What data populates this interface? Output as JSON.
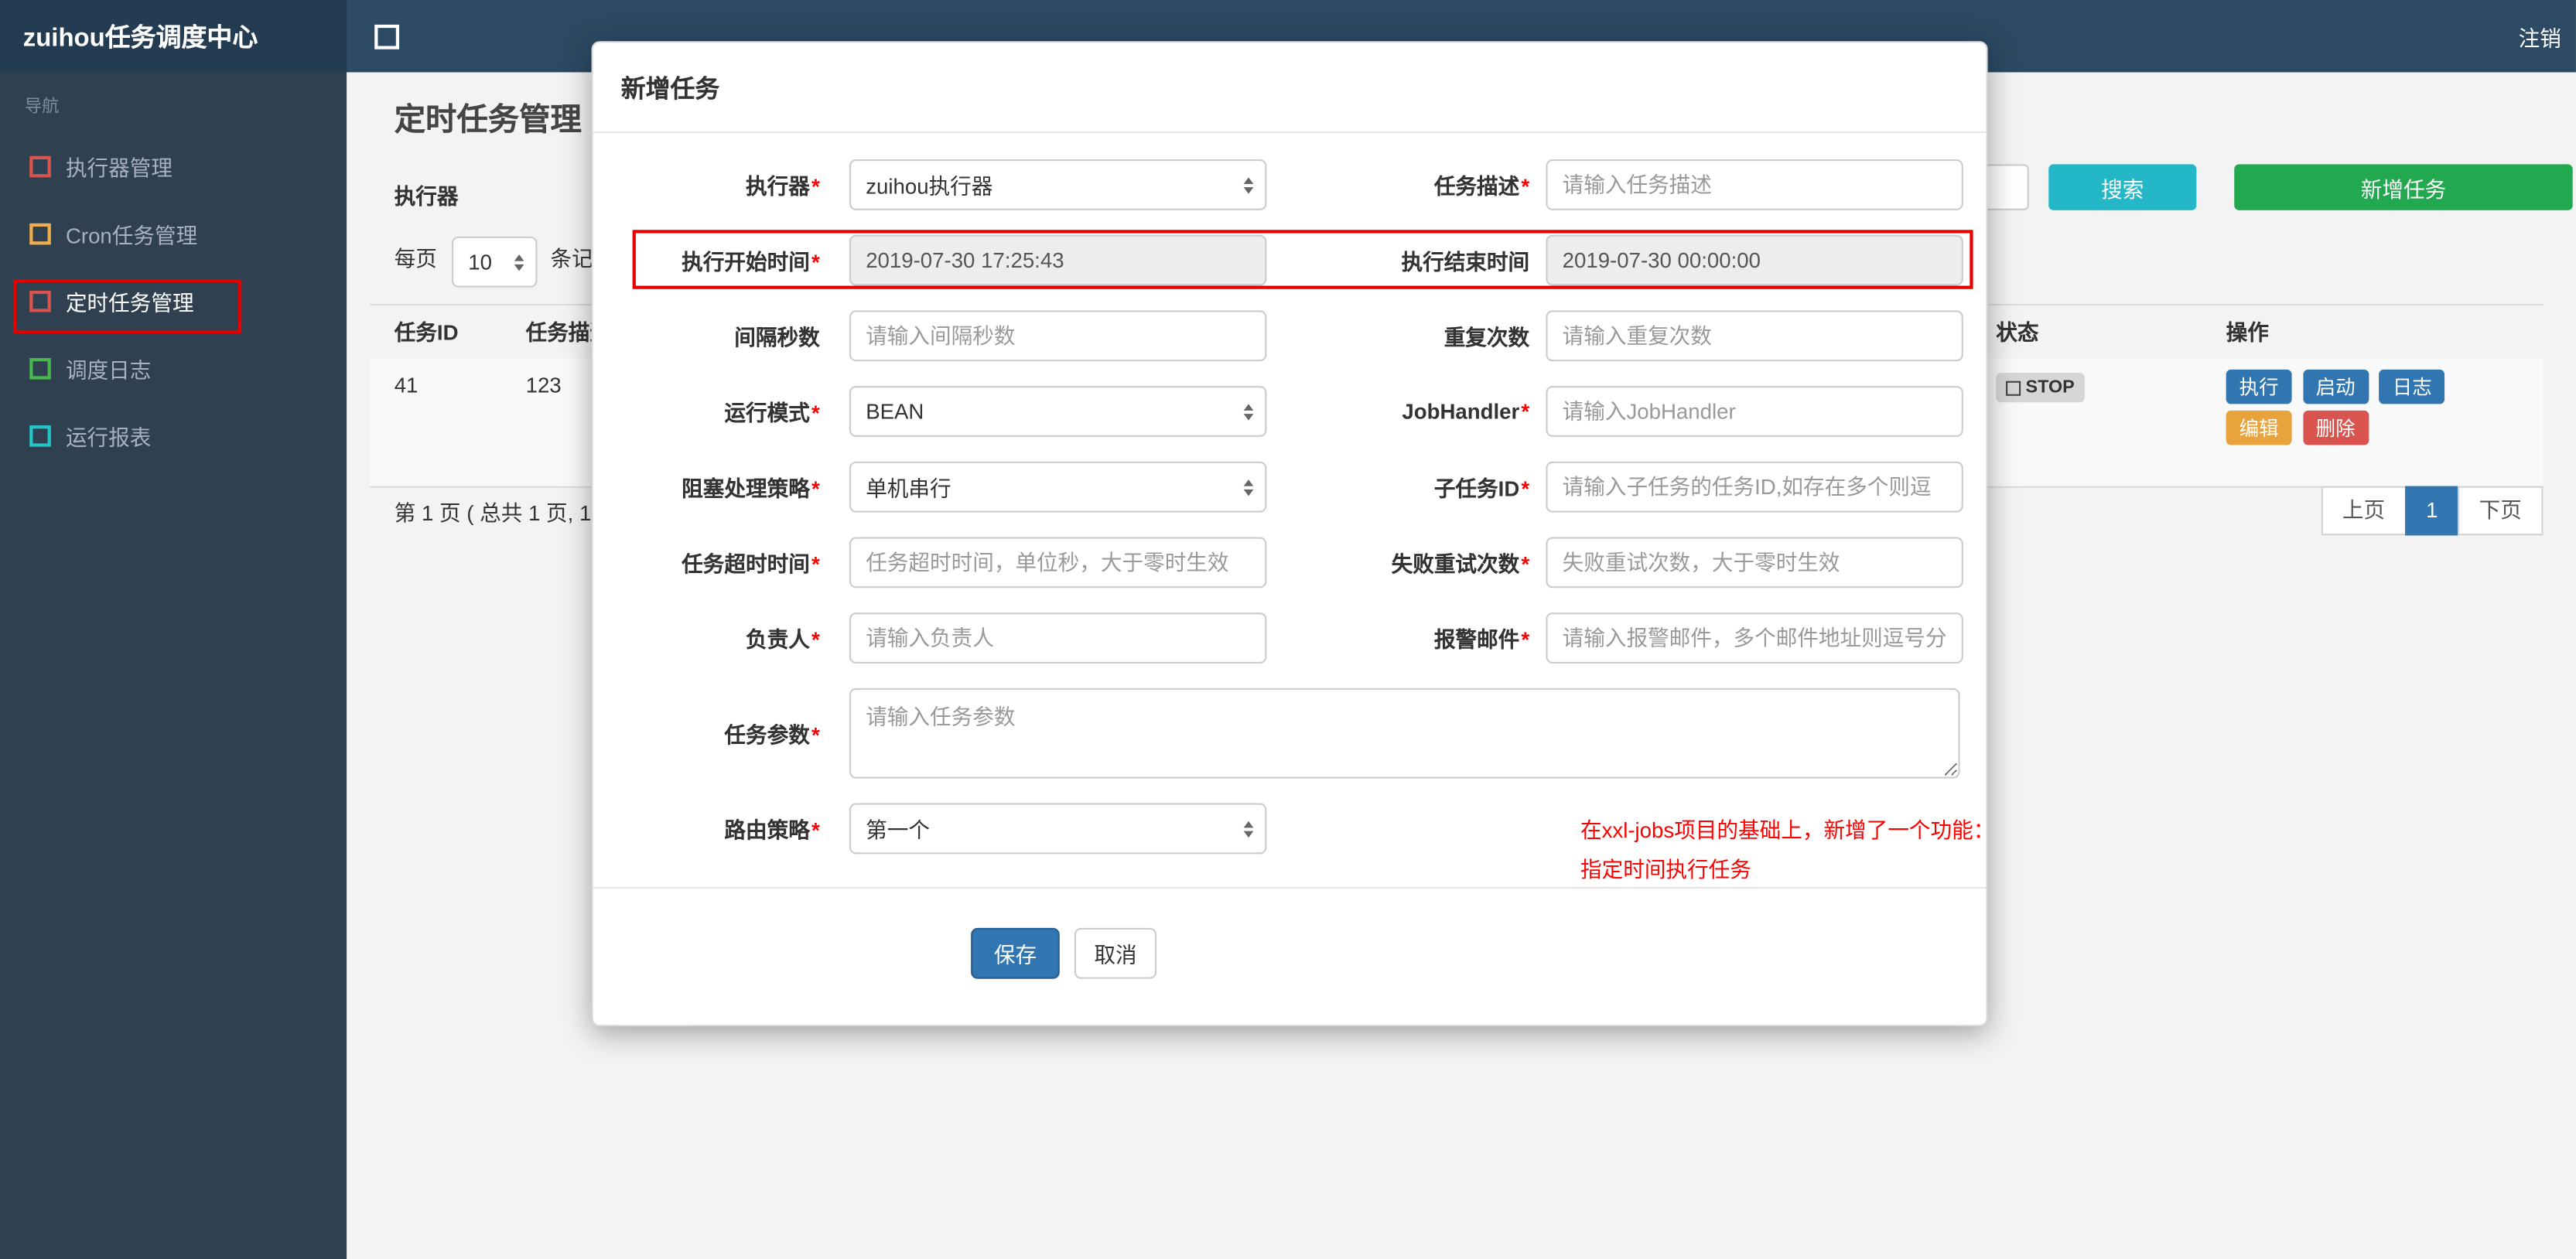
{
  "colors": {
    "brand-bar": "#2c4a63",
    "brand-block": "#243c52",
    "sidebar-bg": "#2f4050",
    "accent-teal": "#23b7c7",
    "accent-green": "#22a94f",
    "accent-blue": "#3276b1",
    "accent-orange": "#e8a33d",
    "accent-red": "#d9534f",
    "annotation-red": "#e60000",
    "icon-red": "#d9534f",
    "icon-orange": "#f0ad4e",
    "icon-green": "#49b64e",
    "icon-teal": "#23c6c8",
    "stop-badge-bg": "#d6d6d6"
  },
  "topbar": {
    "brand": "zuihou任务调度中心",
    "logout": "注销"
  },
  "sidebar": {
    "nav_label": "导航",
    "items": [
      {
        "label": "执行器管理",
        "icon": "square-red"
      },
      {
        "label": "Cron任务管理",
        "icon": "square-orange"
      },
      {
        "label": "定时任务管理",
        "icon": "square-red",
        "active": true
      },
      {
        "label": "调度日志",
        "icon": "square-green"
      },
      {
        "label": "运行报表",
        "icon": "square-teal"
      }
    ]
  },
  "page": {
    "title": "定时任务管理",
    "filter": {
      "executor_label": "执行器",
      "search": "搜索",
      "add": "新增任务"
    },
    "per_page": {
      "label": "每页",
      "value": "10",
      "suffix": "条记录"
    },
    "table": {
      "headers": [
        "任务ID",
        "任务描述",
        "状态",
        "操作"
      ],
      "row": {
        "job_id": "41",
        "job_desc": "123",
        "status": "STOP",
        "op_execute": "执行",
        "op_start": "启动",
        "op_log": "日志",
        "op_edit": "编辑",
        "op_delete": "删除"
      }
    },
    "pagination": {
      "summary": "第 1 页 ( 总共 1 页, 1",
      "prev": "上页",
      "current": "1",
      "next": "下页"
    }
  },
  "modal": {
    "title": "新增任务",
    "required_mark": "*",
    "fields": {
      "executor": {
        "label": "执行器",
        "value": "zuihou执行器"
      },
      "job_desc": {
        "label": "任务描述",
        "placeholder": "请输入任务描述"
      },
      "start_time": {
        "label": "执行开始时间",
        "value": "2019-07-30 17:25:43"
      },
      "end_time": {
        "label": "执行结束时间",
        "value": "2019-07-30 00:00:00"
      },
      "interval": {
        "label": "间隔秒数",
        "placeholder": "请输入间隔秒数"
      },
      "repeat_count": {
        "label": "重复次数",
        "placeholder": "请输入重复次数"
      },
      "run_mode": {
        "label": "运行模式",
        "value": "BEAN"
      },
      "job_handler": {
        "label": "JobHandler",
        "placeholder": "请输入JobHandler"
      },
      "block_strategy": {
        "label": "阻塞处理策略",
        "value": "单机串行"
      },
      "child_job_id": {
        "label": "子任务ID",
        "placeholder": "请输入子任务的任务ID,如存在多个则逗"
      },
      "timeout": {
        "label": "任务超时时间",
        "placeholder": "任务超时时间，单位秒，大于零时生效"
      },
      "fail_retry": {
        "label": "失败重试次数",
        "placeholder": "失败重试次数，大于零时生效"
      },
      "owner": {
        "label": "负责人",
        "placeholder": "请输入负责人"
      },
      "alarm_email": {
        "label": "报警邮件",
        "placeholder": "请输入报警邮件，多个邮件地址则逗号分"
      },
      "job_param": {
        "label": "任务参数",
        "placeholder": "请输入任务参数"
      },
      "route_strategy": {
        "label": "路由策略",
        "value": "第一个"
      }
    },
    "note": {
      "line1": "在xxl-jobs项目的基础上，新增了一个功能：",
      "line2": "指定时间执行任务"
    },
    "save": "保存",
    "cancel": "取消"
  }
}
